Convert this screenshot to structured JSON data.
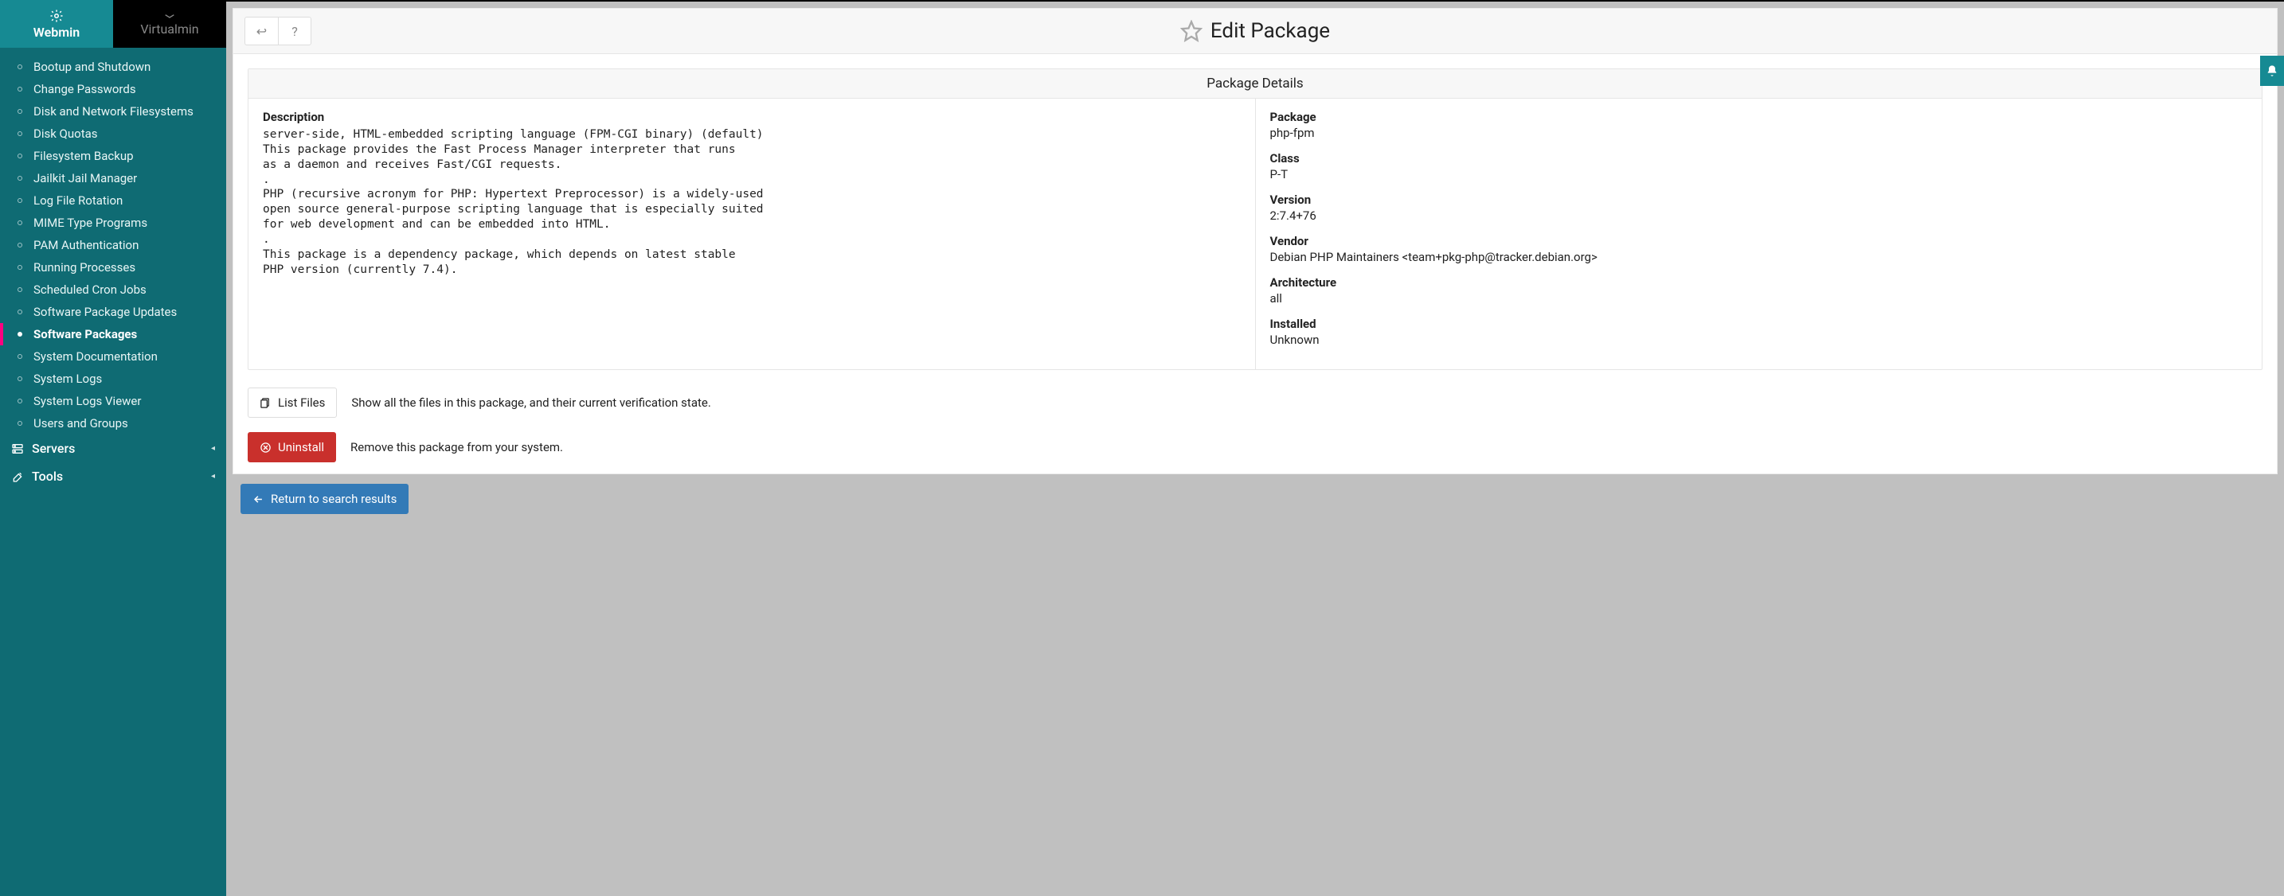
{
  "tabs": {
    "webmin": "Webmin",
    "virtualmin": "Virtualmin"
  },
  "sidebar": {
    "items": [
      "Bootup and Shutdown",
      "Change Passwords",
      "Disk and Network Filesystems",
      "Disk Quotas",
      "Filesystem Backup",
      "Jailkit Jail Manager",
      "Log File Rotation",
      "MIME Type Programs",
      "PAM Authentication",
      "Running Processes",
      "Scheduled Cron Jobs",
      "Software Package Updates",
      "Software Packages",
      "System Documentation",
      "System Logs",
      "System Logs Viewer",
      "Users and Groups"
    ],
    "active_index": 12,
    "sections": {
      "servers": "Servers",
      "tools": "Tools"
    }
  },
  "page": {
    "title": "Edit Package"
  },
  "panel": {
    "title": "Package Details",
    "description_label": "Description",
    "description_text": "server-side, HTML-embedded scripting language (FPM-CGI binary) (default)\nThis package provides the Fast Process Manager interpreter that runs\nas a daemon and receives Fast/CGI requests.\n.\nPHP (recursive acronym for PHP: Hypertext Preprocessor) is a widely-used\nopen source general-purpose scripting language that is especially suited\nfor web development and can be embedded into HTML.\n.\nThis package is a dependency package, which depends on latest stable\nPHP version (currently 7.4).",
    "meta": {
      "package_label": "Package",
      "package_value": "php-fpm",
      "class_label": "Class",
      "class_value": "P-T",
      "version_label": "Version",
      "version_value": "2:7.4+76",
      "vendor_label": "Vendor",
      "vendor_value": "Debian PHP Maintainers <team+pkg-php@tracker.debian.org>",
      "arch_label": "Architecture",
      "arch_value": "all",
      "installed_label": "Installed",
      "installed_value": "Unknown"
    }
  },
  "actions": {
    "list_files_label": "List Files",
    "list_files_desc": "Show all the files in this package, and their current verification state.",
    "uninstall_label": "Uninstall",
    "uninstall_desc": "Remove this package from your system.",
    "return_label": "Return to search results"
  }
}
